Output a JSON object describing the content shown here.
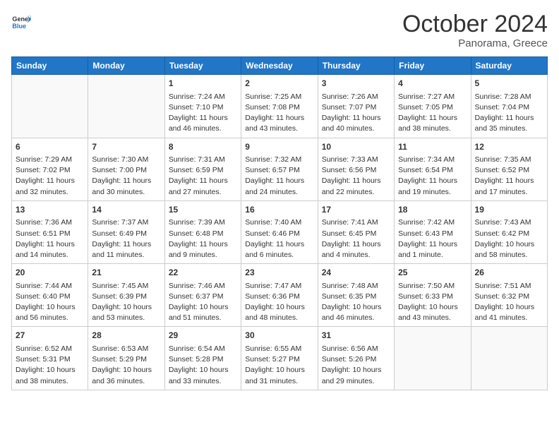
{
  "header": {
    "logo_general": "General",
    "logo_blue": "Blue",
    "month_title": "October 2024",
    "location": "Panorama, Greece"
  },
  "weekdays": [
    "Sunday",
    "Monday",
    "Tuesday",
    "Wednesday",
    "Thursday",
    "Friday",
    "Saturday"
  ],
  "weeks": [
    [
      {
        "day": "",
        "empty": true
      },
      {
        "day": "",
        "empty": true
      },
      {
        "day": "1",
        "sunrise": "Sunrise: 7:24 AM",
        "sunset": "Sunset: 7:10 PM",
        "daylight": "Daylight: 11 hours and 46 minutes."
      },
      {
        "day": "2",
        "sunrise": "Sunrise: 7:25 AM",
        "sunset": "Sunset: 7:08 PM",
        "daylight": "Daylight: 11 hours and 43 minutes."
      },
      {
        "day": "3",
        "sunrise": "Sunrise: 7:26 AM",
        "sunset": "Sunset: 7:07 PM",
        "daylight": "Daylight: 11 hours and 40 minutes."
      },
      {
        "day": "4",
        "sunrise": "Sunrise: 7:27 AM",
        "sunset": "Sunset: 7:05 PM",
        "daylight": "Daylight: 11 hours and 38 minutes."
      },
      {
        "day": "5",
        "sunrise": "Sunrise: 7:28 AM",
        "sunset": "Sunset: 7:04 PM",
        "daylight": "Daylight: 11 hours and 35 minutes."
      }
    ],
    [
      {
        "day": "6",
        "sunrise": "Sunrise: 7:29 AM",
        "sunset": "Sunset: 7:02 PM",
        "daylight": "Daylight: 11 hours and 32 minutes."
      },
      {
        "day": "7",
        "sunrise": "Sunrise: 7:30 AM",
        "sunset": "Sunset: 7:00 PM",
        "daylight": "Daylight: 11 hours and 30 minutes."
      },
      {
        "day": "8",
        "sunrise": "Sunrise: 7:31 AM",
        "sunset": "Sunset: 6:59 PM",
        "daylight": "Daylight: 11 hours and 27 minutes."
      },
      {
        "day": "9",
        "sunrise": "Sunrise: 7:32 AM",
        "sunset": "Sunset: 6:57 PM",
        "daylight": "Daylight: 11 hours and 24 minutes."
      },
      {
        "day": "10",
        "sunrise": "Sunrise: 7:33 AM",
        "sunset": "Sunset: 6:56 PM",
        "daylight": "Daylight: 11 hours and 22 minutes."
      },
      {
        "day": "11",
        "sunrise": "Sunrise: 7:34 AM",
        "sunset": "Sunset: 6:54 PM",
        "daylight": "Daylight: 11 hours and 19 minutes."
      },
      {
        "day": "12",
        "sunrise": "Sunrise: 7:35 AM",
        "sunset": "Sunset: 6:52 PM",
        "daylight": "Daylight: 11 hours and 17 minutes."
      }
    ],
    [
      {
        "day": "13",
        "sunrise": "Sunrise: 7:36 AM",
        "sunset": "Sunset: 6:51 PM",
        "daylight": "Daylight: 11 hours and 14 minutes."
      },
      {
        "day": "14",
        "sunrise": "Sunrise: 7:37 AM",
        "sunset": "Sunset: 6:49 PM",
        "daylight": "Daylight: 11 hours and 11 minutes."
      },
      {
        "day": "15",
        "sunrise": "Sunrise: 7:39 AM",
        "sunset": "Sunset: 6:48 PM",
        "daylight": "Daylight: 11 hours and 9 minutes."
      },
      {
        "day": "16",
        "sunrise": "Sunrise: 7:40 AM",
        "sunset": "Sunset: 6:46 PM",
        "daylight": "Daylight: 11 hours and 6 minutes."
      },
      {
        "day": "17",
        "sunrise": "Sunrise: 7:41 AM",
        "sunset": "Sunset: 6:45 PM",
        "daylight": "Daylight: 11 hours and 4 minutes."
      },
      {
        "day": "18",
        "sunrise": "Sunrise: 7:42 AM",
        "sunset": "Sunset: 6:43 PM",
        "daylight": "Daylight: 11 hours and 1 minute."
      },
      {
        "day": "19",
        "sunrise": "Sunrise: 7:43 AM",
        "sunset": "Sunset: 6:42 PM",
        "daylight": "Daylight: 10 hours and 58 minutes."
      }
    ],
    [
      {
        "day": "20",
        "sunrise": "Sunrise: 7:44 AM",
        "sunset": "Sunset: 6:40 PM",
        "daylight": "Daylight: 10 hours and 56 minutes."
      },
      {
        "day": "21",
        "sunrise": "Sunrise: 7:45 AM",
        "sunset": "Sunset: 6:39 PM",
        "daylight": "Daylight: 10 hours and 53 minutes."
      },
      {
        "day": "22",
        "sunrise": "Sunrise: 7:46 AM",
        "sunset": "Sunset: 6:37 PM",
        "daylight": "Daylight: 10 hours and 51 minutes."
      },
      {
        "day": "23",
        "sunrise": "Sunrise: 7:47 AM",
        "sunset": "Sunset: 6:36 PM",
        "daylight": "Daylight: 10 hours and 48 minutes."
      },
      {
        "day": "24",
        "sunrise": "Sunrise: 7:48 AM",
        "sunset": "Sunset: 6:35 PM",
        "daylight": "Daylight: 10 hours and 46 minutes."
      },
      {
        "day": "25",
        "sunrise": "Sunrise: 7:50 AM",
        "sunset": "Sunset: 6:33 PM",
        "daylight": "Daylight: 10 hours and 43 minutes."
      },
      {
        "day": "26",
        "sunrise": "Sunrise: 7:51 AM",
        "sunset": "Sunset: 6:32 PM",
        "daylight": "Daylight: 10 hours and 41 minutes."
      }
    ],
    [
      {
        "day": "27",
        "sunrise": "Sunrise: 6:52 AM",
        "sunset": "Sunset: 5:31 PM",
        "daylight": "Daylight: 10 hours and 38 minutes."
      },
      {
        "day": "28",
        "sunrise": "Sunrise: 6:53 AM",
        "sunset": "Sunset: 5:29 PM",
        "daylight": "Daylight: 10 hours and 36 minutes."
      },
      {
        "day": "29",
        "sunrise": "Sunrise: 6:54 AM",
        "sunset": "Sunset: 5:28 PM",
        "daylight": "Daylight: 10 hours and 33 minutes."
      },
      {
        "day": "30",
        "sunrise": "Sunrise: 6:55 AM",
        "sunset": "Sunset: 5:27 PM",
        "daylight": "Daylight: 10 hours and 31 minutes."
      },
      {
        "day": "31",
        "sunrise": "Sunrise: 6:56 AM",
        "sunset": "Sunset: 5:26 PM",
        "daylight": "Daylight: 10 hours and 29 minutes."
      },
      {
        "day": "",
        "empty": true
      },
      {
        "day": "",
        "empty": true
      }
    ]
  ]
}
